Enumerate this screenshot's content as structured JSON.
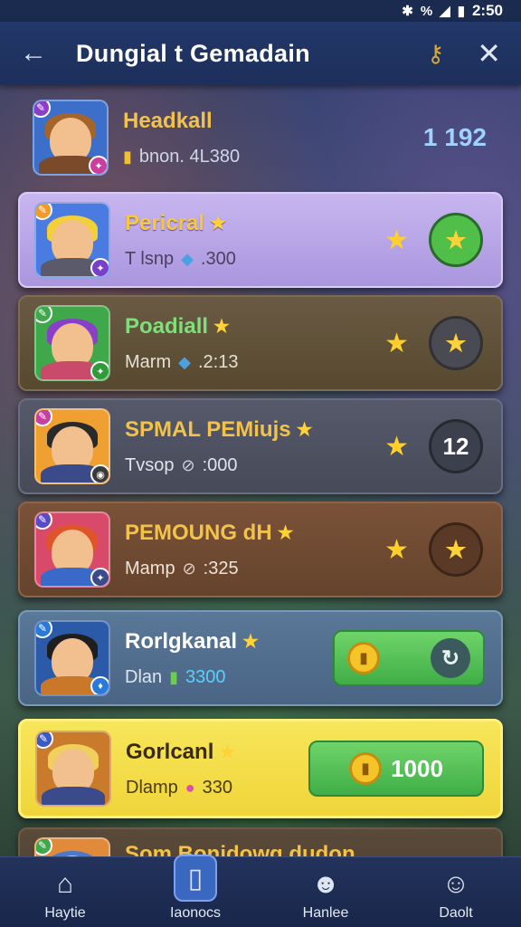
{
  "status": {
    "time": "2:50",
    "icons": [
      "bluetooth-icon",
      "percent-icon",
      "signal-icon",
      "battery-icon"
    ]
  },
  "header": {
    "title": "Dungial t Gemadain"
  },
  "top_row": {
    "name": "Headkall",
    "sub": "bnon. 4L380",
    "score": "1 192"
  },
  "rows": [
    {
      "name": "Pericral",
      "sub_label": "T lsnp",
      "sub_value": ".300",
      "action": "★",
      "theme": "purple"
    },
    {
      "name": "Poadiall",
      "sub_label": "Marm",
      "sub_value": ".2:13",
      "action": "★",
      "theme": "brown"
    },
    {
      "name": "SPMAL PEMiujs",
      "sub_label": "Tvsop",
      "sub_value": ":000",
      "action": "12",
      "theme": "slate"
    },
    {
      "name": "PEMOUNG dH",
      "sub_label": "Mamp",
      "sub_value": ":325",
      "action": "★",
      "theme": "rust"
    },
    {
      "name": "Rorlgkanal",
      "sub_label": "Dlan",
      "sub_value": "3300",
      "theme": "blue"
    },
    {
      "name": "Gorlcanl",
      "sub_label": "Dlamp",
      "sub_value": "330",
      "coins": "1000",
      "theme": "yellow"
    },
    {
      "name": "Som Bonidowg dudon",
      "theme": "brown2"
    }
  ],
  "nav": [
    {
      "label": "Haytie",
      "icon": "home-icon"
    },
    {
      "label": "Iaonocs",
      "icon": "tablet-icon"
    },
    {
      "label": "Hanlee",
      "icon": "people-icon"
    },
    {
      "label": "Daolt",
      "icon": "profile-icon"
    }
  ],
  "colors": {
    "accent": "#3a67c0",
    "highlight": "#f6e24a",
    "button_green": "#4fbf4a"
  }
}
